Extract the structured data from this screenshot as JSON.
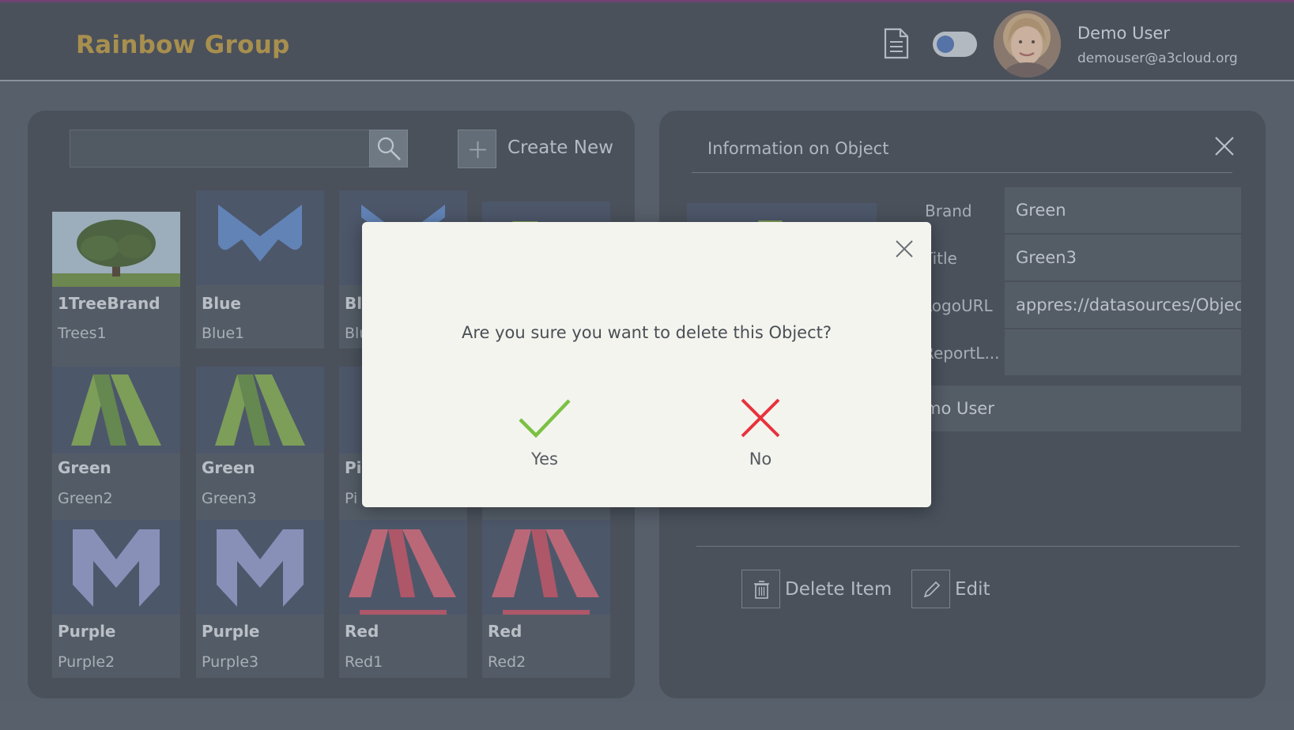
{
  "header": {
    "brand": "Rainbow Group",
    "doc_icon": "document-icon",
    "theme_toggle": "toggle-switch",
    "user": {
      "name": "Demo User",
      "email": "demouser@a3cloud.org"
    }
  },
  "left_panel": {
    "search": {
      "placeholder": "",
      "icon": "search-icon"
    },
    "create_label": "Create New",
    "tiles": [
      {
        "brand": "1TreeBrand",
        "title": "Trees1"
      },
      {
        "brand": "Blue",
        "title": "Blue1"
      },
      {
        "brand": "Blu",
        "title": "Blu"
      },
      {
        "brand": "",
        "title": ""
      },
      {
        "brand": "Green",
        "title": "Green2"
      },
      {
        "brand": "Green",
        "title": "Green3"
      },
      {
        "brand": "Pi",
        "title": "Pi"
      },
      {
        "brand": "",
        "title": ""
      },
      {
        "brand": "Purple",
        "title": "Purple2"
      },
      {
        "brand": "Purple",
        "title": "Purple3"
      },
      {
        "brand": "Red",
        "title": "Red1"
      },
      {
        "brand": "Red",
        "title": "Red2"
      }
    ]
  },
  "info_panel": {
    "title": "Information on Object",
    "fields": [
      {
        "label": "Brand",
        "value": "Green"
      },
      {
        "label": "Title",
        "value": "Green3"
      },
      {
        "label": "LogoURL",
        "value": "appres://datasources/Objects"
      },
      {
        "label": "ReportL...",
        "value": ""
      }
    ],
    "owner": "mo User",
    "delete_label": "Delete Item",
    "edit_label": "Edit"
  },
  "dialog": {
    "message": "Are you sure you want to delete this Object?",
    "yes_label": "Yes",
    "no_label": "No"
  },
  "colors": {
    "brand": "#b8953a",
    "yes": "#7bc142",
    "no": "#e8323c"
  }
}
